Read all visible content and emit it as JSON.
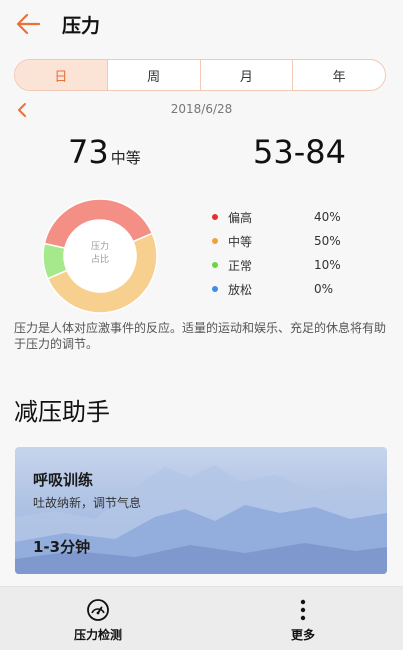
{
  "header": {
    "title": "压力",
    "back_icon": "arrow-left-icon",
    "accent": "#e8713c"
  },
  "tabs": [
    {
      "label": "日",
      "active": true
    },
    {
      "label": "周",
      "active": false
    },
    {
      "label": "月",
      "active": false
    },
    {
      "label": "年",
      "active": false
    }
  ],
  "date": {
    "value": "2018/6/28",
    "prev_icon": "chevron-left-icon"
  },
  "summary": {
    "value": "73",
    "level": "中等",
    "range": "53-84"
  },
  "donut": {
    "label_line1": "压力",
    "label_line2": "占比",
    "segments": [
      {
        "name": "偏高",
        "percent": 40,
        "color": "#f48f86"
      },
      {
        "name": "中等",
        "percent": 50,
        "color": "#f7cf8e"
      },
      {
        "name": "正常",
        "percent": 10,
        "color": "#a6e88c"
      },
      {
        "name": "放松",
        "percent": 0,
        "color": "#3f8ee8"
      }
    ]
  },
  "legend": [
    {
      "name": "偏高",
      "value": "40%",
      "color": "#e8302b"
    },
    {
      "name": "中等",
      "value": "50%",
      "color": "#f0a33c"
    },
    {
      "name": "正常",
      "value": "10%",
      "color": "#6cd63a"
    },
    {
      "name": "放松",
      "value": "0%",
      "color": "#3f8ee8"
    }
  ],
  "description": "压力是人体对应激事件的反应。适量的运动和娱乐、充足的休息将有助于压力的调节。",
  "section": {
    "title": "减压助手"
  },
  "card": {
    "title": "呼吸训练",
    "subtitle": "吐故纳新，调节气息",
    "duration": "1-3分钟"
  },
  "bottom_bar": {
    "detect_label": "压力检测",
    "detect_icon": "gauge-icon",
    "more_label": "更多",
    "more_icon": "more-vertical-icon"
  }
}
